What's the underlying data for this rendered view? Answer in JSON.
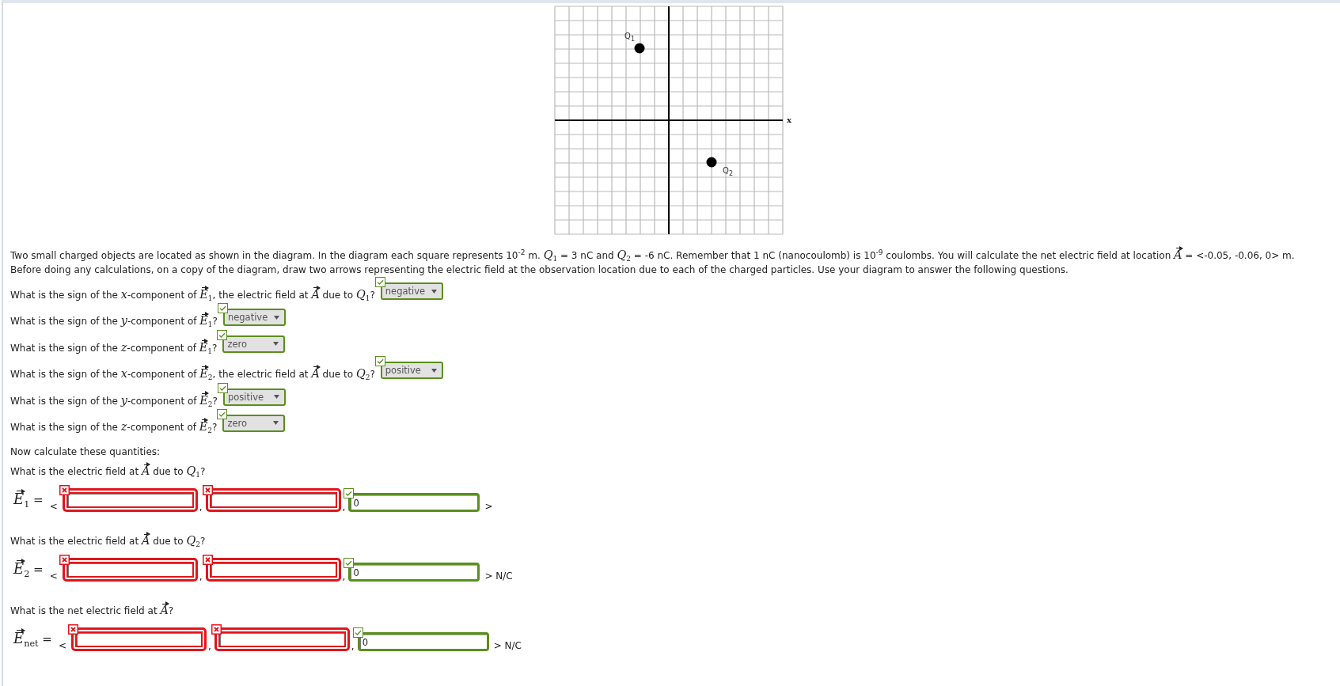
{
  "diagram": {
    "axis_label": "x",
    "charges": [
      {
        "label": "Q$_{1}$"
      },
      {
        "label": "Q$_{2}$"
      }
    ]
  },
  "intro": [
    "Two small charged objects are located as shown in the diagram. In the diagram each square represents 10$^{-2}$ m. *Q*$_{1}$ = 3 nC and *Q*$_{2}$ = -6 nC. Remember that 1 nC (nanocoulomb) is 10$^{-9}$ coulombs. You will calculate the net electric field at location *A⃗* = <-0.05, -0.06, 0> m.",
    "Before doing any calculations, on a copy of the diagram, draw two arrows representing the electric field at the observation location due to each of the charged particles. Use your diagram to answer the following questions."
  ],
  "sign_questions": [
    {
      "text": "What is the sign of the *x*-component of *E⃗*$_{1}$, the electric field at *A⃗* due to *Q*$_{1}$?",
      "answer": "negative",
      "correct": true
    },
    {
      "text": "What is the sign of the *y*-component of *E⃗*$_{1}$?",
      "answer": "negative",
      "correct": true
    },
    {
      "text": "What is the sign of the *z*-component of *E⃗*$_{1}$?",
      "answer": "zero",
      "correct": true
    },
    {
      "text": "What is the sign of the *x*-component of *E⃗*$_{2}$, the electric field at *A⃗* due to *Q*$_{2}$?",
      "answer": "positive",
      "correct": true
    },
    {
      "text": "What is the sign of the *y*-component of *E⃗*$_{2}$?",
      "answer": "positive",
      "correct": true
    },
    {
      "text": "What is the sign of the *z*-component of *E⃗*$_{2}$?",
      "answer": "zero",
      "correct": true
    }
  ],
  "calc_heading": "Now calculate these quantities:",
  "vector_questions": [
    {
      "prompt": "What is the electric field at *A⃗* due to *Q*$_{1}$?",
      "label": "*E⃗*$_{1}$ =",
      "open": "<",
      "components": [
        {
          "correct": false,
          "separator": ","
        },
        {
          "correct": false,
          "separator": ","
        },
        {
          "value": "0",
          "correct": true
        }
      ],
      "close": ">"
    },
    {
      "prompt": "What is the electric field at *A⃗* due to *Q*$_{2}$?",
      "label": "*E⃗*$_{2}$ =",
      "open": "<",
      "components": [
        {
          "correct": false,
          "separator": ","
        },
        {
          "correct": false,
          "separator": ","
        },
        {
          "value": "0",
          "correct": true
        }
      ],
      "close": "> N/C"
    },
    {
      "prompt": "What is the net electric field at *A⃗*?",
      "label": "*E⃗*$_{net}$ =",
      "open": "<",
      "components": [
        {
          "correct": false,
          "separator": ","
        },
        {
          "correct": false,
          "separator": ","
        },
        {
          "value": "0",
          "correct": true
        }
      ],
      "close": "> N/C"
    }
  ]
}
